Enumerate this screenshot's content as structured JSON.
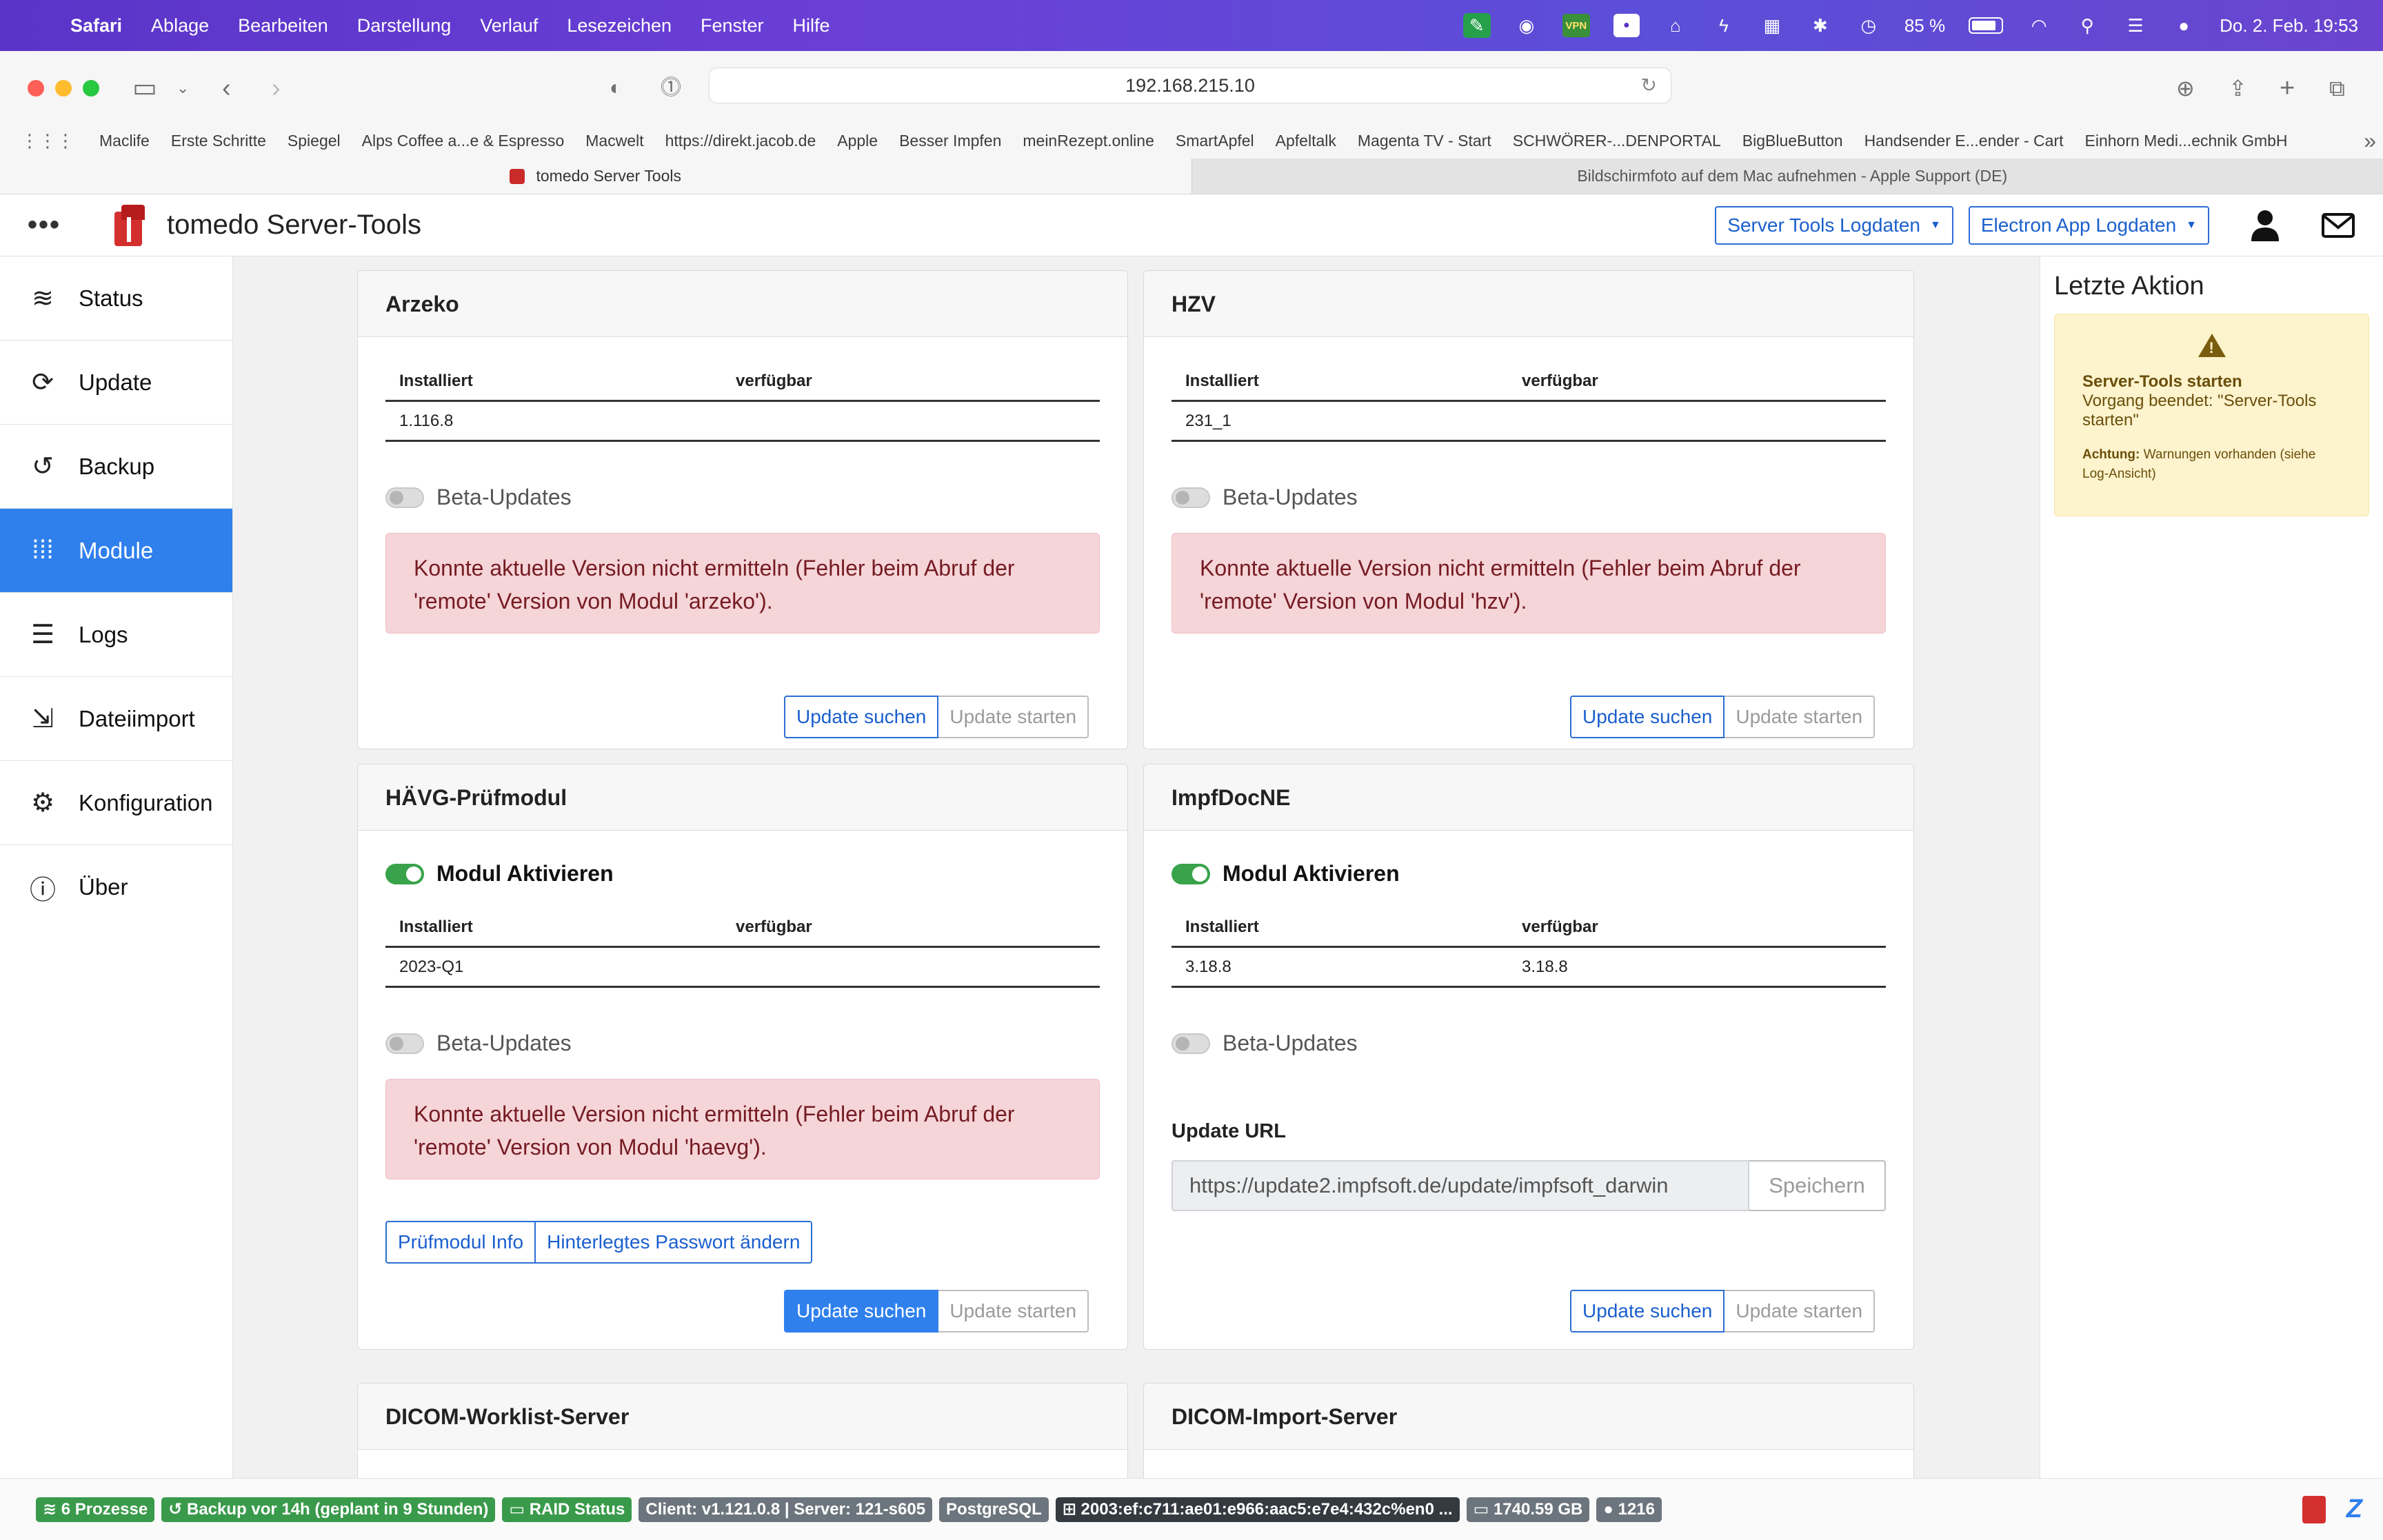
{
  "menubar": {
    "app": "Safari",
    "items": [
      "Ablage",
      "Bearbeiten",
      "Darstellung",
      "Verlauf",
      "Lesezeichen",
      "Fenster",
      "Hilfe"
    ],
    "vpn_label": "VPN",
    "battery": "85 %",
    "battery_level": 0.85,
    "datetime": "Do. 2. Feb.  19:53"
  },
  "browser": {
    "url": "192.168.215.10",
    "bookmarks": [
      "Maclife",
      "Erste Schritte",
      "Spiegel",
      "Alps Coffee a...e & Espresso",
      "Macwelt",
      "https://direkt.jacob.de",
      "Apple",
      "Besser Impfen",
      "meinRezept.online",
      "SmartApfel",
      "Apfeltalk",
      "Magenta TV - Start",
      "SCHWÖRER-...DENPORTAL",
      "BigBlueButton",
      "Handsender E...ender - Cart",
      "Einhorn Medi...echnik GmbH"
    ],
    "tabs": [
      {
        "label": "tomedo Server Tools",
        "active": true
      },
      {
        "label": "Bildschirmfoto auf dem Mac aufnehmen - Apple Support (DE)",
        "active": false
      }
    ]
  },
  "header": {
    "title": "tomedo Server-Tools",
    "dropdown1": "Server Tools Logdaten",
    "dropdown2": "Electron App Logdaten"
  },
  "sidebar": {
    "items": [
      {
        "label": "Status",
        "icon": "layers-icon"
      },
      {
        "label": "Update",
        "icon": "refresh-icon"
      },
      {
        "label": "Backup",
        "icon": "history-icon"
      },
      {
        "label": "Module",
        "icon": "grid-icon",
        "active": true
      },
      {
        "label": "Logs",
        "icon": "list-icon"
      },
      {
        "label": "Dateiimport",
        "icon": "file-import-icon"
      },
      {
        "label": "Konfiguration",
        "icon": "gear-icon"
      },
      {
        "label": "Über",
        "icon": "info-icon"
      }
    ]
  },
  "modules": {
    "col_installed": "Installiert",
    "col_available": "verfügbar",
    "beta_label": "Beta-Updates",
    "activate_label": "Modul Aktivieren",
    "btn_search": "Update suchen",
    "btn_start": "Update starten",
    "arzeko": {
      "title": "Arzeko",
      "installed": "1.116.8",
      "available": "",
      "error": "Konnte aktuelle Version nicht ermitteln (Fehler beim Abruf der 'remote' Version von Modul 'arzeko')."
    },
    "hzv": {
      "title": "HZV",
      "installed": "231_1",
      "available": "",
      "error": "Konnte aktuelle Version nicht ermitteln (Fehler beim Abruf der 'remote' Version von Modul 'hzv')."
    },
    "haevg": {
      "title": "HÄVG-Prüfmodul",
      "installed": "2023-Q1",
      "available": "",
      "error": "Konnte aktuelle Version nicht ermitteln (Fehler beim Abruf der 'remote' Version von Modul 'haevg').",
      "btn_info": "Prüfmodul Info",
      "btn_password": "Hinterlegtes Passwort ändern"
    },
    "impfdoc": {
      "title": "ImpfDocNE",
      "installed": "3.18.8",
      "available": "3.18.8",
      "update_url_label": "Update URL",
      "update_url": "https://update2.impfsoft.de/update/impfsoft_darwin",
      "save_label": "Speichern"
    },
    "dicom_worklist": {
      "title": "DICOM-Worklist-Server"
    },
    "dicom_import": {
      "title": "DICOM-Import-Server"
    }
  },
  "right_panel": {
    "title": "Letzte Aktion",
    "heading": "Server-Tools starten",
    "text": "Vorgang beendet: \"Server-Tools starten\"",
    "note_bold": "Achtung:",
    "note": " Warnungen vorhanden (siehe Log-Ansicht)"
  },
  "footer": {
    "processes": "6 Prozesse",
    "backup": "Backup vor 14h (geplant in 9 Stunden)",
    "raid": "RAID Status",
    "version": "Client: v1.121.0.8 | Server: 121-s605",
    "db": "PostgreSQL",
    "ip": "2003:ef:c711:ae01:e966:aac5:e7e4:432c%en0 ...",
    "disk": "1740.59 GB",
    "users": "1216"
  }
}
